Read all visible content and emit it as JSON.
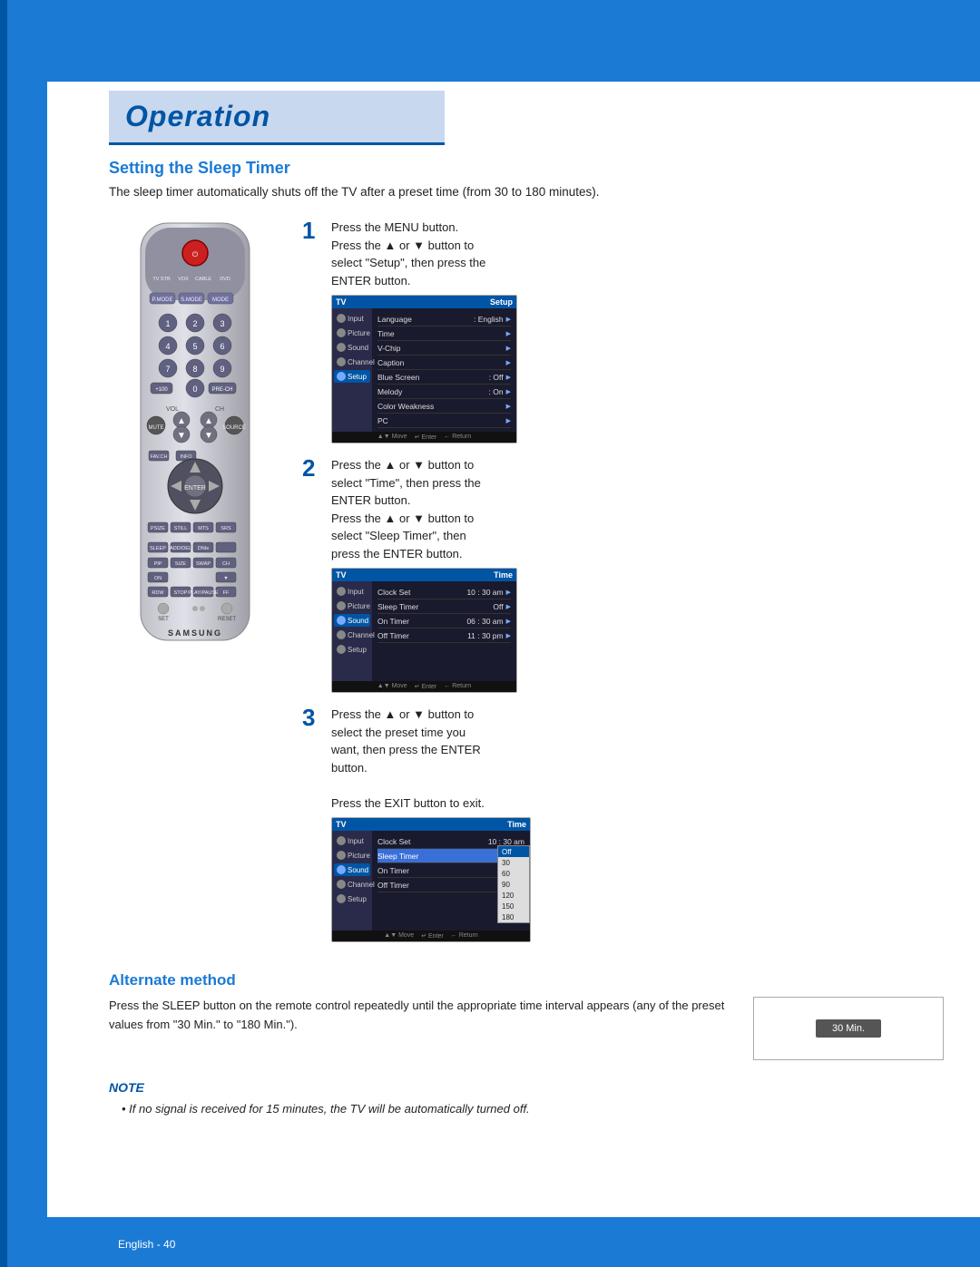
{
  "page": {
    "title": "Operation",
    "section_title": "Setting the Sleep Timer",
    "intro": "The sleep timer automatically shuts off the TV after a preset time (from 30 to 180 minutes).",
    "steps": [
      {
        "number": "1",
        "lines": [
          "Press the MENU button.",
          "Press the ▲ or ▼ button to",
          "select \"Setup\", then press the",
          "ENTER button."
        ],
        "screen": {
          "title": "TV",
          "menu_name": "Setup",
          "sidebar_items": [
            "Input",
            "Picture",
            "Sound",
            "Channel",
            "Setup"
          ],
          "active_sidebar": "Setup",
          "rows": [
            {
              "label": "Language",
              "value": ": English",
              "arrow": true
            },
            {
              "label": "Time",
              "value": "",
              "arrow": true
            },
            {
              "label": "V-Chip",
              "value": "",
              "arrow": true
            },
            {
              "label": "Caption",
              "value": "",
              "arrow": true
            },
            {
              "label": "Blue Screen",
              "value": ": Off",
              "arrow": true
            },
            {
              "label": "Melody",
              "value": ": On",
              "arrow": true
            },
            {
              "label": "Color Weakness",
              "value": "",
              "arrow": true
            },
            {
              "label": "PC",
              "value": "",
              "arrow": true
            }
          ],
          "footer": "▲▼ Move  ↵ Enter  ← Return"
        }
      },
      {
        "number": "2",
        "lines": [
          "Press the ▲ or ▼ button to",
          "select \"Time\", then press the",
          "ENTER button.",
          "Press the ▲ or ▼ button to",
          "select \"Sleep Timer\", then",
          "press the ENTER button."
        ],
        "screen": {
          "title": "TV",
          "menu_name": "Time",
          "sidebar_items": [
            "Input",
            "Picture",
            "Sound",
            "Channel",
            "Setup"
          ],
          "active_sidebar": "Sound",
          "rows": [
            {
              "label": "Clock Set",
              "value": "10 : 30 am",
              "arrow": true
            },
            {
              "label": "Sleep Timer",
              "value": "Off",
              "arrow": true
            },
            {
              "label": "On Timer",
              "value": "06 : 30 am",
              "arrow": true
            },
            {
              "label": "Off Timer",
              "value": "11 : 30 pm",
              "arrow": true
            }
          ],
          "footer": "▲▼ Move  ↵ Enter  ← Return"
        }
      },
      {
        "number": "3",
        "lines": [
          "Press the ▲ or ▼ button to",
          "select the preset time you",
          "want, then press the ENTER",
          "button.",
          "",
          "Press the EXIT button to exit."
        ],
        "screen": {
          "title": "TV",
          "menu_name": "Time",
          "sidebar_items": [
            "Input",
            "Picture",
            "Sound",
            "Channel",
            "Setup"
          ],
          "active_sidebar": "Sound",
          "rows": [
            {
              "label": "Clock Set",
              "value": "10 : 30 am",
              "arrow": false
            },
            {
              "label": "Sleep Timer",
              "value": "",
              "arrow": false,
              "highlight": true
            },
            {
              "label": "On Timer",
              "value": "06",
              "arrow": false
            },
            {
              "label": "Off Timer",
              "value": "11",
              "arrow": false
            }
          ],
          "dropdown": [
            "Off",
            "30",
            "60",
            "90",
            "120",
            "150",
            "180"
          ],
          "selected": "Off",
          "footer": "▲▼ Move  ↵ Enter  ← Return"
        }
      }
    ],
    "alternate": {
      "heading": "Alternate method",
      "text": "Press the SLEEP button on the remote control repeatedly until the appropriate time interval appears (any of the preset values from \"30 Min.\" to \"180 Min.\").",
      "display": "30 Min."
    },
    "note": {
      "heading": "NOTE",
      "text": "If no signal is received for 15 minutes, the TV will be automatically turned off."
    },
    "footer": {
      "language": "English",
      "page": "40"
    }
  }
}
